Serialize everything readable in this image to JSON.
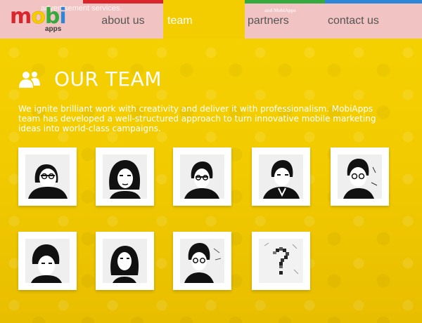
{
  "header": {
    "ghost_text": "advertisement services.",
    "ghost_text_right": "and MobiApps",
    "logo": {
      "word_m": "m",
      "word_o": "o",
      "word_b": "b",
      "word_i": "i",
      "apps": "apps"
    },
    "nav": [
      {
        "label": "about us",
        "active": false
      },
      {
        "label": "team",
        "active": true
      },
      {
        "label": "partners",
        "active": false
      },
      {
        "label": "contact us",
        "active": false
      }
    ],
    "strip_colors": [
      "#d8262c",
      "#f4cd00",
      "#35a93d",
      "#2d86d6"
    ]
  },
  "main": {
    "title": "OUR TEAM",
    "intro": "We ignite brilliant work with creativity and deliver it with professionalism. MobiApps team has developed a well-structured approach to turn innovative mobile marketing ideas into world-class campaigns.",
    "members": [
      {
        "photo": "team-member-photo-1"
      },
      {
        "photo": "team-member-photo-2"
      },
      {
        "photo": "team-member-photo-3"
      },
      {
        "photo": "team-member-photo-4"
      },
      {
        "photo": "team-member-photo-5"
      },
      {
        "photo": "team-member-photo-6"
      },
      {
        "photo": "team-member-photo-7"
      },
      {
        "photo": "team-member-photo-8"
      },
      {
        "photo": "question-mark-placeholder"
      }
    ]
  },
  "colors": {
    "background": "#f4cd00",
    "header_bg": "#f2c3c3",
    "logo_red": "#d8262c",
    "logo_blue": "#2d86d6",
    "nav_text": "#555555",
    "text": "#ffffff"
  }
}
